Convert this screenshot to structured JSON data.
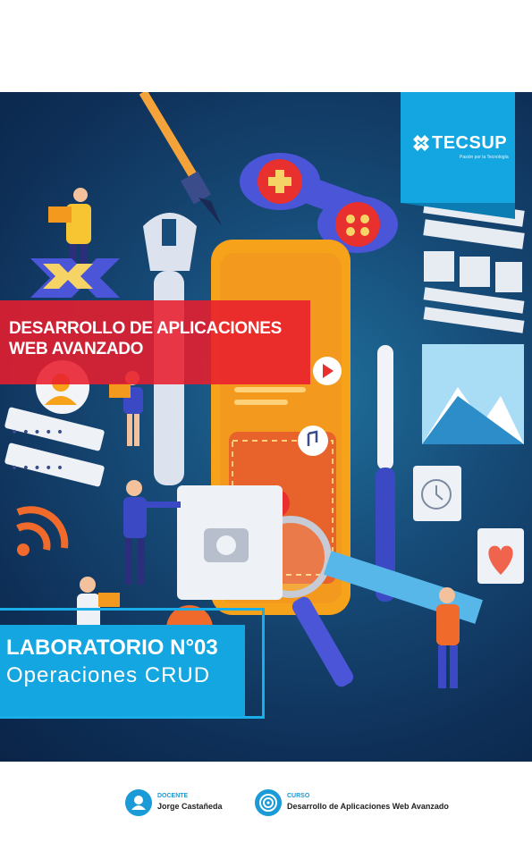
{
  "brand": {
    "name": "TECSUP",
    "tagline": "Pasión por la Tecnología",
    "color": "#14a6e0"
  },
  "cover": {
    "course_title_line1": "DESARROLLO DE APLICACIONES",
    "course_title_line2": "WEB AVANZADO",
    "lab_title": "LABORATORIO N°03",
    "lab_subtitle": "Operaciones CRUD",
    "band_color": "#e81e2d"
  },
  "footer": {
    "docente_label": "DOCENTE",
    "docente_name": "Jorge Castañeda",
    "curso_label": "CURSO",
    "curso_name": "Desarrollo de Aplicaciones Web Avanzado",
    "docente_icon": "user-icon",
    "curso_icon": "target-icon"
  }
}
